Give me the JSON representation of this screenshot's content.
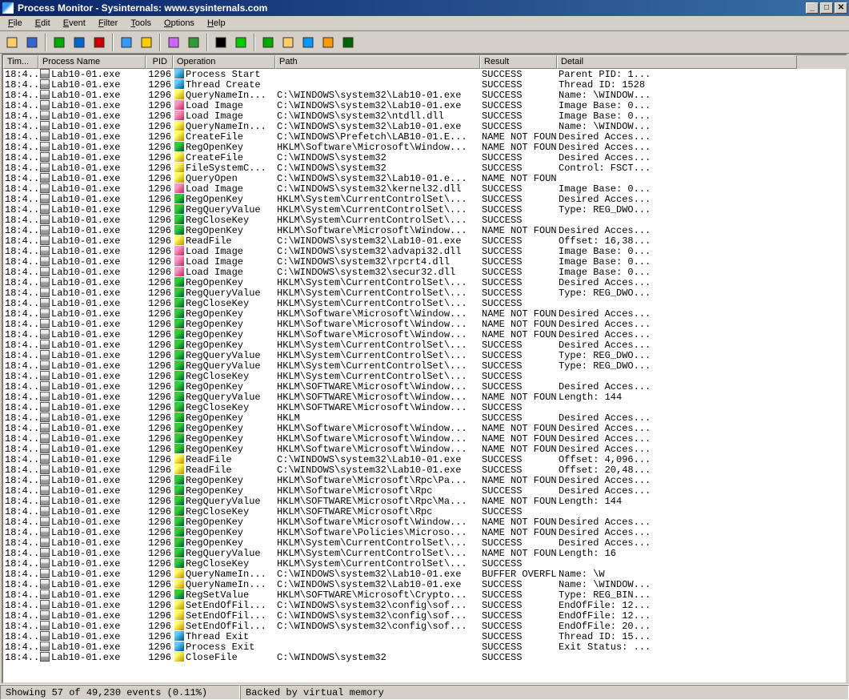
{
  "title": "Process Monitor - Sysinternals: www.sysinternals.com",
  "menu": [
    "File",
    "Edit",
    "Event",
    "Filter",
    "Tools",
    "Options",
    "Help"
  ],
  "columns": [
    "Tim...",
    "Process Name",
    "PID",
    "Operation",
    "Path",
    "Result",
    "Detail"
  ],
  "status": {
    "left": "Showing 57 of 49,230 events (0.11%)",
    "right": "Backed by virtual memory"
  },
  "toolbar_icons": [
    "open-icon",
    "save-icon",
    "sep",
    "capture-icon",
    "autoscroll-icon",
    "clear-icon",
    "sep",
    "filter-icon",
    "highlight-icon",
    "sep",
    "include-process-icon",
    "process-tree-icon",
    "sep",
    "find-icon",
    "jump-icon",
    "sep",
    "show-registry-icon",
    "show-file-icon",
    "show-network-icon",
    "show-process-icon",
    "show-profiling-icon"
  ],
  "rows": [
    {
      "t": "18:4...",
      "p": "Lab10-01.exe",
      "pid": "1296",
      "op": "Process Start",
      "oc": "proc",
      "path": "",
      "res": "SUCCESS",
      "det": "Parent PID: 1..."
    },
    {
      "t": "18:4...",
      "p": "Lab10-01.exe",
      "pid": "1296",
      "op": "Thread Create",
      "oc": "proc",
      "path": "",
      "res": "SUCCESS",
      "det": "Thread ID: 1528"
    },
    {
      "t": "18:4...",
      "p": "Lab10-01.exe",
      "pid": "1296",
      "op": "QueryNameIn...",
      "oc": "file",
      "path": "C:\\WINDOWS\\system32\\Lab10-01.exe",
      "res": "SUCCESS",
      "det": "Name: \\WINDOW..."
    },
    {
      "t": "18:4...",
      "p": "Lab10-01.exe",
      "pid": "1296",
      "op": "Load Image",
      "oc": "img",
      "path": "C:\\WINDOWS\\system32\\Lab10-01.exe",
      "res": "SUCCESS",
      "det": "Image Base: 0..."
    },
    {
      "t": "18:4...",
      "p": "Lab10-01.exe",
      "pid": "1296",
      "op": "Load Image",
      "oc": "img",
      "path": "C:\\WINDOWS\\system32\\ntdll.dll",
      "res": "SUCCESS",
      "det": "Image Base: 0..."
    },
    {
      "t": "18:4...",
      "p": "Lab10-01.exe",
      "pid": "1296",
      "op": "QueryNameIn...",
      "oc": "file",
      "path": "C:\\WINDOWS\\system32\\Lab10-01.exe",
      "res": "SUCCESS",
      "det": "Name: \\WINDOW..."
    },
    {
      "t": "18:4...",
      "p": "Lab10-01.exe",
      "pid": "1296",
      "op": "CreateFile",
      "oc": "file",
      "path": "C:\\WINDOWS\\Prefetch\\LAB10-01.E...",
      "res": "NAME NOT FOUND",
      "det": "Desired Acces..."
    },
    {
      "t": "18:4...",
      "p": "Lab10-01.exe",
      "pid": "1296",
      "op": "RegOpenKey",
      "oc": "reg",
      "path": "HKLM\\Software\\Microsoft\\Window...",
      "res": "NAME NOT FOUND",
      "det": "Desired Acces..."
    },
    {
      "t": "18:4...",
      "p": "Lab10-01.exe",
      "pid": "1296",
      "op": "CreateFile",
      "oc": "file",
      "path": "C:\\WINDOWS\\system32",
      "res": "SUCCESS",
      "det": "Desired Acces..."
    },
    {
      "t": "18:4...",
      "p": "Lab10-01.exe",
      "pid": "1296",
      "op": "FileSystemC...",
      "oc": "file",
      "path": "C:\\WINDOWS\\system32",
      "res": "SUCCESS",
      "det": "Control: FSCT..."
    },
    {
      "t": "18:4...",
      "p": "Lab10-01.exe",
      "pid": "1296",
      "op": "QueryOpen",
      "oc": "file",
      "path": "C:\\WINDOWS\\system32\\Lab10-01.e...",
      "res": "NAME NOT FOUND",
      "det": ""
    },
    {
      "t": "18:4...",
      "p": "Lab10-01.exe",
      "pid": "1296",
      "op": "Load Image",
      "oc": "img",
      "path": "C:\\WINDOWS\\system32\\kernel32.dll",
      "res": "SUCCESS",
      "det": "Image Base: 0..."
    },
    {
      "t": "18:4...",
      "p": "Lab10-01.exe",
      "pid": "1296",
      "op": "RegOpenKey",
      "oc": "reg",
      "path": "HKLM\\System\\CurrentControlSet\\...",
      "res": "SUCCESS",
      "det": "Desired Acces..."
    },
    {
      "t": "18:4...",
      "p": "Lab10-01.exe",
      "pid": "1296",
      "op": "RegQueryValue",
      "oc": "reg",
      "path": "HKLM\\System\\CurrentControlSet\\...",
      "res": "SUCCESS",
      "det": "Type: REG_DWO..."
    },
    {
      "t": "18:4...",
      "p": "Lab10-01.exe",
      "pid": "1296",
      "op": "RegCloseKey",
      "oc": "reg",
      "path": "HKLM\\System\\CurrentControlSet\\...",
      "res": "SUCCESS",
      "det": ""
    },
    {
      "t": "18:4...",
      "p": "Lab10-01.exe",
      "pid": "1296",
      "op": "RegOpenKey",
      "oc": "reg",
      "path": "HKLM\\Software\\Microsoft\\Window...",
      "res": "NAME NOT FOUND",
      "det": "Desired Acces..."
    },
    {
      "t": "18:4...",
      "p": "Lab10-01.exe",
      "pid": "1296",
      "op": "ReadFile",
      "oc": "file",
      "path": "C:\\WINDOWS\\system32\\Lab10-01.exe",
      "res": "SUCCESS",
      "det": "Offset: 16,38..."
    },
    {
      "t": "18:4...",
      "p": "Lab10-01.exe",
      "pid": "1296",
      "op": "Load Image",
      "oc": "img",
      "path": "C:\\WINDOWS\\system32\\advapi32.dll",
      "res": "SUCCESS",
      "det": "Image Base: 0..."
    },
    {
      "t": "18:4...",
      "p": "Lab10-01.exe",
      "pid": "1296",
      "op": "Load Image",
      "oc": "img",
      "path": "C:\\WINDOWS\\system32\\rpcrt4.dll",
      "res": "SUCCESS",
      "det": "Image Base: 0..."
    },
    {
      "t": "18:4...",
      "p": "Lab10-01.exe",
      "pid": "1296",
      "op": "Load Image",
      "oc": "img",
      "path": "C:\\WINDOWS\\system32\\secur32.dll",
      "res": "SUCCESS",
      "det": "Image Base: 0..."
    },
    {
      "t": "18:4...",
      "p": "Lab10-01.exe",
      "pid": "1296",
      "op": "RegOpenKey",
      "oc": "reg",
      "path": "HKLM\\System\\CurrentControlSet\\...",
      "res": "SUCCESS",
      "det": "Desired Acces..."
    },
    {
      "t": "18:4...",
      "p": "Lab10-01.exe",
      "pid": "1296",
      "op": "RegQueryValue",
      "oc": "reg",
      "path": "HKLM\\System\\CurrentControlSet\\...",
      "res": "SUCCESS",
      "det": "Type: REG_DWO..."
    },
    {
      "t": "18:4...",
      "p": "Lab10-01.exe",
      "pid": "1296",
      "op": "RegCloseKey",
      "oc": "reg",
      "path": "HKLM\\System\\CurrentControlSet\\...",
      "res": "SUCCESS",
      "det": ""
    },
    {
      "t": "18:4...",
      "p": "Lab10-01.exe",
      "pid": "1296",
      "op": "RegOpenKey",
      "oc": "reg",
      "path": "HKLM\\Software\\Microsoft\\Window...",
      "res": "NAME NOT FOUND",
      "det": "Desired Acces..."
    },
    {
      "t": "18:4...",
      "p": "Lab10-01.exe",
      "pid": "1296",
      "op": "RegOpenKey",
      "oc": "reg",
      "path": "HKLM\\Software\\Microsoft\\Window...",
      "res": "NAME NOT FOUND",
      "det": "Desired Acces..."
    },
    {
      "t": "18:4...",
      "p": "Lab10-01.exe",
      "pid": "1296",
      "op": "RegOpenKey",
      "oc": "reg",
      "path": "HKLM\\Software\\Microsoft\\Window...",
      "res": "NAME NOT FOUND",
      "det": "Desired Acces..."
    },
    {
      "t": "18:4...",
      "p": "Lab10-01.exe",
      "pid": "1296",
      "op": "RegOpenKey",
      "oc": "reg",
      "path": "HKLM\\System\\CurrentControlSet\\...",
      "res": "SUCCESS",
      "det": "Desired Acces..."
    },
    {
      "t": "18:4...",
      "p": "Lab10-01.exe",
      "pid": "1296",
      "op": "RegQueryValue",
      "oc": "reg",
      "path": "HKLM\\System\\CurrentControlSet\\...",
      "res": "SUCCESS",
      "det": "Type: REG_DWO..."
    },
    {
      "t": "18:4...",
      "p": "Lab10-01.exe",
      "pid": "1296",
      "op": "RegQueryValue",
      "oc": "reg",
      "path": "HKLM\\System\\CurrentControlSet\\...",
      "res": "SUCCESS",
      "det": "Type: REG_DWO..."
    },
    {
      "t": "18:4...",
      "p": "Lab10-01.exe",
      "pid": "1296",
      "op": "RegCloseKey",
      "oc": "reg",
      "path": "HKLM\\System\\CurrentControlSet\\...",
      "res": "SUCCESS",
      "det": ""
    },
    {
      "t": "18:4...",
      "p": "Lab10-01.exe",
      "pid": "1296",
      "op": "RegOpenKey",
      "oc": "reg",
      "path": "HKLM\\SOFTWARE\\Microsoft\\Window...",
      "res": "SUCCESS",
      "det": "Desired Acces..."
    },
    {
      "t": "18:4...",
      "p": "Lab10-01.exe",
      "pid": "1296",
      "op": "RegQueryValue",
      "oc": "reg",
      "path": "HKLM\\SOFTWARE\\Microsoft\\Window...",
      "res": "NAME NOT FOUND",
      "det": "Length: 144"
    },
    {
      "t": "18:4...",
      "p": "Lab10-01.exe",
      "pid": "1296",
      "op": "RegCloseKey",
      "oc": "reg",
      "path": "HKLM\\SOFTWARE\\Microsoft\\Window...",
      "res": "SUCCESS",
      "det": ""
    },
    {
      "t": "18:4...",
      "p": "Lab10-01.exe",
      "pid": "1296",
      "op": "RegOpenKey",
      "oc": "reg",
      "path": "HKLM",
      "res": "SUCCESS",
      "det": "Desired Acces..."
    },
    {
      "t": "18:4...",
      "p": "Lab10-01.exe",
      "pid": "1296",
      "op": "RegOpenKey",
      "oc": "reg",
      "path": "HKLM\\Software\\Microsoft\\Window...",
      "res": "NAME NOT FOUND",
      "det": "Desired Acces..."
    },
    {
      "t": "18:4...",
      "p": "Lab10-01.exe",
      "pid": "1296",
      "op": "RegOpenKey",
      "oc": "reg",
      "path": "HKLM\\Software\\Microsoft\\Window...",
      "res": "NAME NOT FOUND",
      "det": "Desired Acces..."
    },
    {
      "t": "18:4...",
      "p": "Lab10-01.exe",
      "pid": "1296",
      "op": "RegOpenKey",
      "oc": "reg",
      "path": "HKLM\\Software\\Microsoft\\Window...",
      "res": "NAME NOT FOUND",
      "det": "Desired Acces..."
    },
    {
      "t": "18:4...",
      "p": "Lab10-01.exe",
      "pid": "1296",
      "op": "ReadFile",
      "oc": "file",
      "path": "C:\\WINDOWS\\system32\\Lab10-01.exe",
      "res": "SUCCESS",
      "det": "Offset: 4,096..."
    },
    {
      "t": "18:4...",
      "p": "Lab10-01.exe",
      "pid": "1296",
      "op": "ReadFile",
      "oc": "file",
      "path": "C:\\WINDOWS\\system32\\Lab10-01.exe",
      "res": "SUCCESS",
      "det": "Offset: 20,48..."
    },
    {
      "t": "18:4...",
      "p": "Lab10-01.exe",
      "pid": "1296",
      "op": "RegOpenKey",
      "oc": "reg",
      "path": "HKLM\\Software\\Microsoft\\Rpc\\Pa...",
      "res": "NAME NOT FOUND",
      "det": "Desired Acces..."
    },
    {
      "t": "18:4...",
      "p": "Lab10-01.exe",
      "pid": "1296",
      "op": "RegOpenKey",
      "oc": "reg",
      "path": "HKLM\\Software\\Microsoft\\Rpc",
      "res": "SUCCESS",
      "det": "Desired Acces..."
    },
    {
      "t": "18:4...",
      "p": "Lab10-01.exe",
      "pid": "1296",
      "op": "RegQueryValue",
      "oc": "reg",
      "path": "HKLM\\SOFTWARE\\Microsoft\\Rpc\\Ma...",
      "res": "NAME NOT FOUND",
      "det": "Length: 144"
    },
    {
      "t": "18:4...",
      "p": "Lab10-01.exe",
      "pid": "1296",
      "op": "RegCloseKey",
      "oc": "reg",
      "path": "HKLM\\SOFTWARE\\Microsoft\\Rpc",
      "res": "SUCCESS",
      "det": ""
    },
    {
      "t": "18:4...",
      "p": "Lab10-01.exe",
      "pid": "1296",
      "op": "RegOpenKey",
      "oc": "reg",
      "path": "HKLM\\Software\\Microsoft\\Window...",
      "res": "NAME NOT FOUND",
      "det": "Desired Acces..."
    },
    {
      "t": "18:4...",
      "p": "Lab10-01.exe",
      "pid": "1296",
      "op": "RegOpenKey",
      "oc": "reg",
      "path": "HKLM\\Software\\Policies\\Microso...",
      "res": "NAME NOT FOUND",
      "det": "Desired Acces..."
    },
    {
      "t": "18:4...",
      "p": "Lab10-01.exe",
      "pid": "1296",
      "op": "RegOpenKey",
      "oc": "reg",
      "path": "HKLM\\System\\CurrentControlSet\\...",
      "res": "SUCCESS",
      "det": "Desired Acces..."
    },
    {
      "t": "18:4...",
      "p": "Lab10-01.exe",
      "pid": "1296",
      "op": "RegQueryValue",
      "oc": "reg",
      "path": "HKLM\\System\\CurrentControlSet\\...",
      "res": "NAME NOT FOUND",
      "det": "Length: 16"
    },
    {
      "t": "18:4...",
      "p": "Lab10-01.exe",
      "pid": "1296",
      "op": "RegCloseKey",
      "oc": "reg",
      "path": "HKLM\\System\\CurrentControlSet\\...",
      "res": "SUCCESS",
      "det": ""
    },
    {
      "t": "18:4...",
      "p": "Lab10-01.exe",
      "pid": "1296",
      "op": "QueryNameIn...",
      "oc": "file",
      "path": "C:\\WINDOWS\\system32\\Lab10-01.exe",
      "res": "BUFFER OVERFLOW",
      "det": "Name: \\W"
    },
    {
      "t": "18:4...",
      "p": "Lab10-01.exe",
      "pid": "1296",
      "op": "QueryNameIn...",
      "oc": "file",
      "path": "C:\\WINDOWS\\system32\\Lab10-01.exe",
      "res": "SUCCESS",
      "det": "Name: \\WINDOW..."
    },
    {
      "t": "18:4...",
      "p": "Lab10-01.exe",
      "pid": "1296",
      "op": "RegSetValue",
      "oc": "reg",
      "path": "HKLM\\SOFTWARE\\Microsoft\\Crypto...",
      "res": "SUCCESS",
      "det": "Type: REG_BIN..."
    },
    {
      "t": "18:4...",
      "p": "Lab10-01.exe",
      "pid": "1296",
      "op": "SetEndOfFil...",
      "oc": "file",
      "path": "C:\\WINDOWS\\system32\\config\\sof...",
      "res": "SUCCESS",
      "det": "EndOfFile: 12..."
    },
    {
      "t": "18:4...",
      "p": "Lab10-01.exe",
      "pid": "1296",
      "op": "SetEndOfFil...",
      "oc": "file",
      "path": "C:\\WINDOWS\\system32\\config\\sof...",
      "res": "SUCCESS",
      "det": "EndOfFile: 12..."
    },
    {
      "t": "18:4...",
      "p": "Lab10-01.exe",
      "pid": "1296",
      "op": "SetEndOfFil...",
      "oc": "file",
      "path": "C:\\WINDOWS\\system32\\config\\sof...",
      "res": "SUCCESS",
      "det": "EndOfFile: 20..."
    },
    {
      "t": "18:4...",
      "p": "Lab10-01.exe",
      "pid": "1296",
      "op": "Thread Exit",
      "oc": "proc",
      "path": "",
      "res": "SUCCESS",
      "det": "Thread ID: 15..."
    },
    {
      "t": "18:4...",
      "p": "Lab10-01.exe",
      "pid": "1296",
      "op": "Process Exit",
      "oc": "proc",
      "path": "",
      "res": "SUCCESS",
      "det": "Exit Status: ..."
    },
    {
      "t": "18:4...",
      "p": "Lab10-01.exe",
      "pid": "1296",
      "op": "CloseFile",
      "oc": "file",
      "path": "C:\\WINDOWS\\system32",
      "res": "SUCCESS",
      "det": ""
    }
  ]
}
